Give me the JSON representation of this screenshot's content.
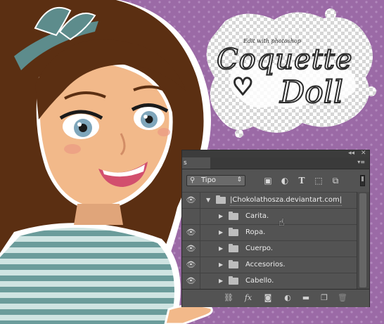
{
  "artwork": {
    "watermark": "Edit with photoshop",
    "logo_word_1": "Coquette",
    "logo_word_2": "Doll",
    "colors": {
      "background": "#9b6aa6",
      "dots": "#b188bc",
      "hair": "#5b2f12",
      "skin": "#f2b98a",
      "bow": "#5d8c8c",
      "shirt_stripe_light": "#cfe4e2",
      "shirt_stripe_dark": "#6b9c9b"
    }
  },
  "layers_panel": {
    "tab_label": "s",
    "collapse_icon": "double-arrow-icon",
    "close_icon": "close-icon",
    "menu_icon": "panel-menu-icon",
    "filter": {
      "kind_label": "Tipo",
      "icons": [
        "image-filter-icon",
        "adjustment-filter-icon",
        "type-filter-icon",
        "shape-filter-icon",
        "smart-object-filter-icon"
      ]
    },
    "group": {
      "name": "|Chokolathosza.deviantart.com|",
      "expanded": true
    },
    "layers": [
      {
        "name": "Carita."
      },
      {
        "name": "Ropa."
      },
      {
        "name": "Cuerpo."
      },
      {
        "name": "Accesorios."
      },
      {
        "name": "Cabello."
      }
    ],
    "bottom_icons": [
      "link-icon",
      "fx-icon",
      "mask-icon",
      "adjustment-icon",
      "folder-icon",
      "new-layer-icon",
      "trash-icon"
    ],
    "fx_label": "fx"
  }
}
